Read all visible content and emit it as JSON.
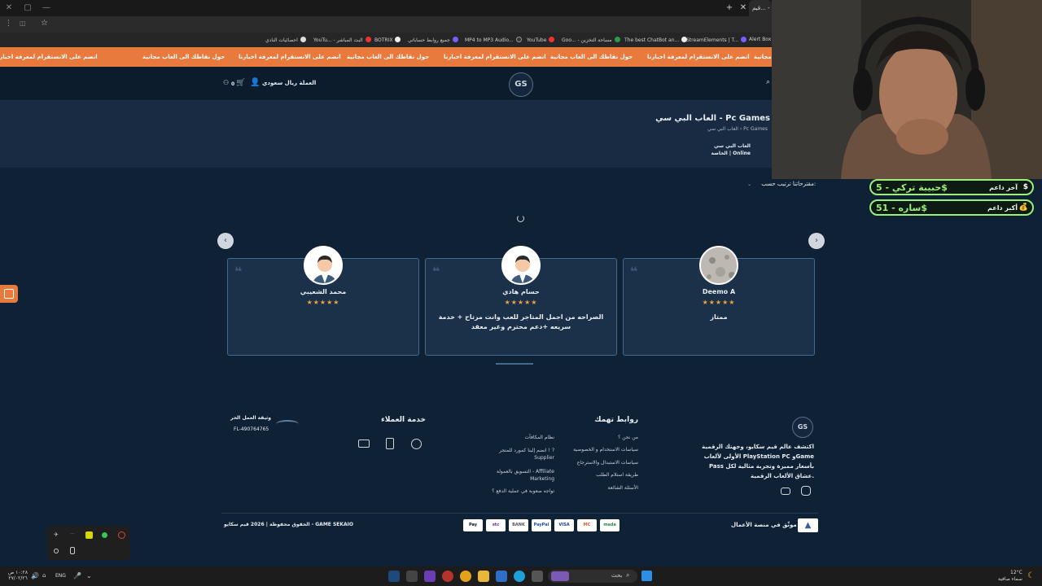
{
  "browser": {
    "active_tab": "قيم... - Pc",
    "bookmarks": [
      "احصائيات النادي",
      "YouTu... - البث المباشر",
      "BOTRIX",
      "جميع روابط حساباتي",
      "MP4 to MP3 Audio...",
      "Goo... - مساحة التخزين",
      "YouTube",
      "The best ChatBot an...",
      "StreamElements | T...",
      "Alert Box"
    ]
  },
  "ticker": {
    "items": [
      "انضم على الانستقرام لمعرفة اخبارنا",
      "حول نقاطك الى العاب مجانية",
      "انضم على الانستقرام لمعرفة اخبارنا",
      "حول نقاطك الى العاب مجانية",
      "انضم على الانستقرام لمعرفة اخبارنا",
      "حول نقاطك الى العاب مجانية",
      "انضم على الانستقرام لمعرفة اخبارنا",
      "حول نقاطك الى العاب مجانية"
    ]
  },
  "header": {
    "logo": "GS",
    "currency": "العملة ريال سعودي",
    "cart_count": "0"
  },
  "hero": {
    "title": "العاب البي سي - Pc Games",
    "breadcrumb": "العاب البي سي  ›  Pc Games",
    "category_line1": "العاب البي سي",
    "category_line2": "الخاصة | Online"
  },
  "sort": {
    "label": "ترتيب حسب:",
    "value": "مقترحاتنا"
  },
  "reviews": [
    {
      "name": "Deemo A",
      "stars": "★★★★★",
      "text": "ممتاز"
    },
    {
      "name": "حسام هادي",
      "stars": "★★★★★",
      "text": "الصراحه من اجمل المتاجر للعب وانت مرتاح + خدمة سريعه +دعم محترم وغير معقد"
    },
    {
      "name": "محمد الشعيبي",
      "stars": "★★★★★",
      "text": ""
    }
  ],
  "footer": {
    "about": "اكتشف عالم قيم سكايو، وجهتك الرقمية الأولى لألعاب PlayStation PC وGame Pass بأسعار مميزة وتجربة مثالية لكل عشاق الألعاب الرقمية.",
    "links_title": "روابط تهمك",
    "links": [
      "من نحن ؟",
      "سياسات الاستخدام و الخصوصية",
      "سياسات الاستبدال والاسترجاع",
      "طريقة استلام الطلب",
      "الأسئلة الشائعة"
    ],
    "service_title": "خدمة العملاء",
    "service_links": [
      "نظام المكافآت",
      "انضم إلينا كمورد للمتجر ! ? Supplier",
      "التسويق بالعمولة - Affiliate Marketing",
      "تواجه صعوبة في عملية الدفع ؟"
    ],
    "license_title": "وثيقة العمل الحر",
    "license_no": "FL-490764765",
    "trusted": "موثّق في منصة الأعمال",
    "copyright": "الحقوق محفوظة | 2026 قيم سكايو - GAME SEKAIO",
    "payments": [
      "Pay",
      "stc",
      "BANK",
      "PayPal",
      "VISA",
      "MC",
      "mada"
    ]
  },
  "donors": [
    {
      "label": "آخر داعم",
      "value": "حبيبة تركي - 5$"
    },
    {
      "label": "أكبر داعم",
      "value": "ساره - 51$"
    }
  ],
  "taskbar": {
    "search": "بحث",
    "lang": "ENG",
    "weather_temp": "12°C",
    "weather_text": "سماء صافية",
    "time": "١٠:٢٨ ص",
    "date": "٢٧/٠٢/٢٦"
  },
  "colors": {
    "accent": "#e87a3e",
    "page_bg": "#0f2135",
    "card_border": "#3f6c8f",
    "star": "#f2a23a",
    "donor_green": "#9cf07a"
  }
}
